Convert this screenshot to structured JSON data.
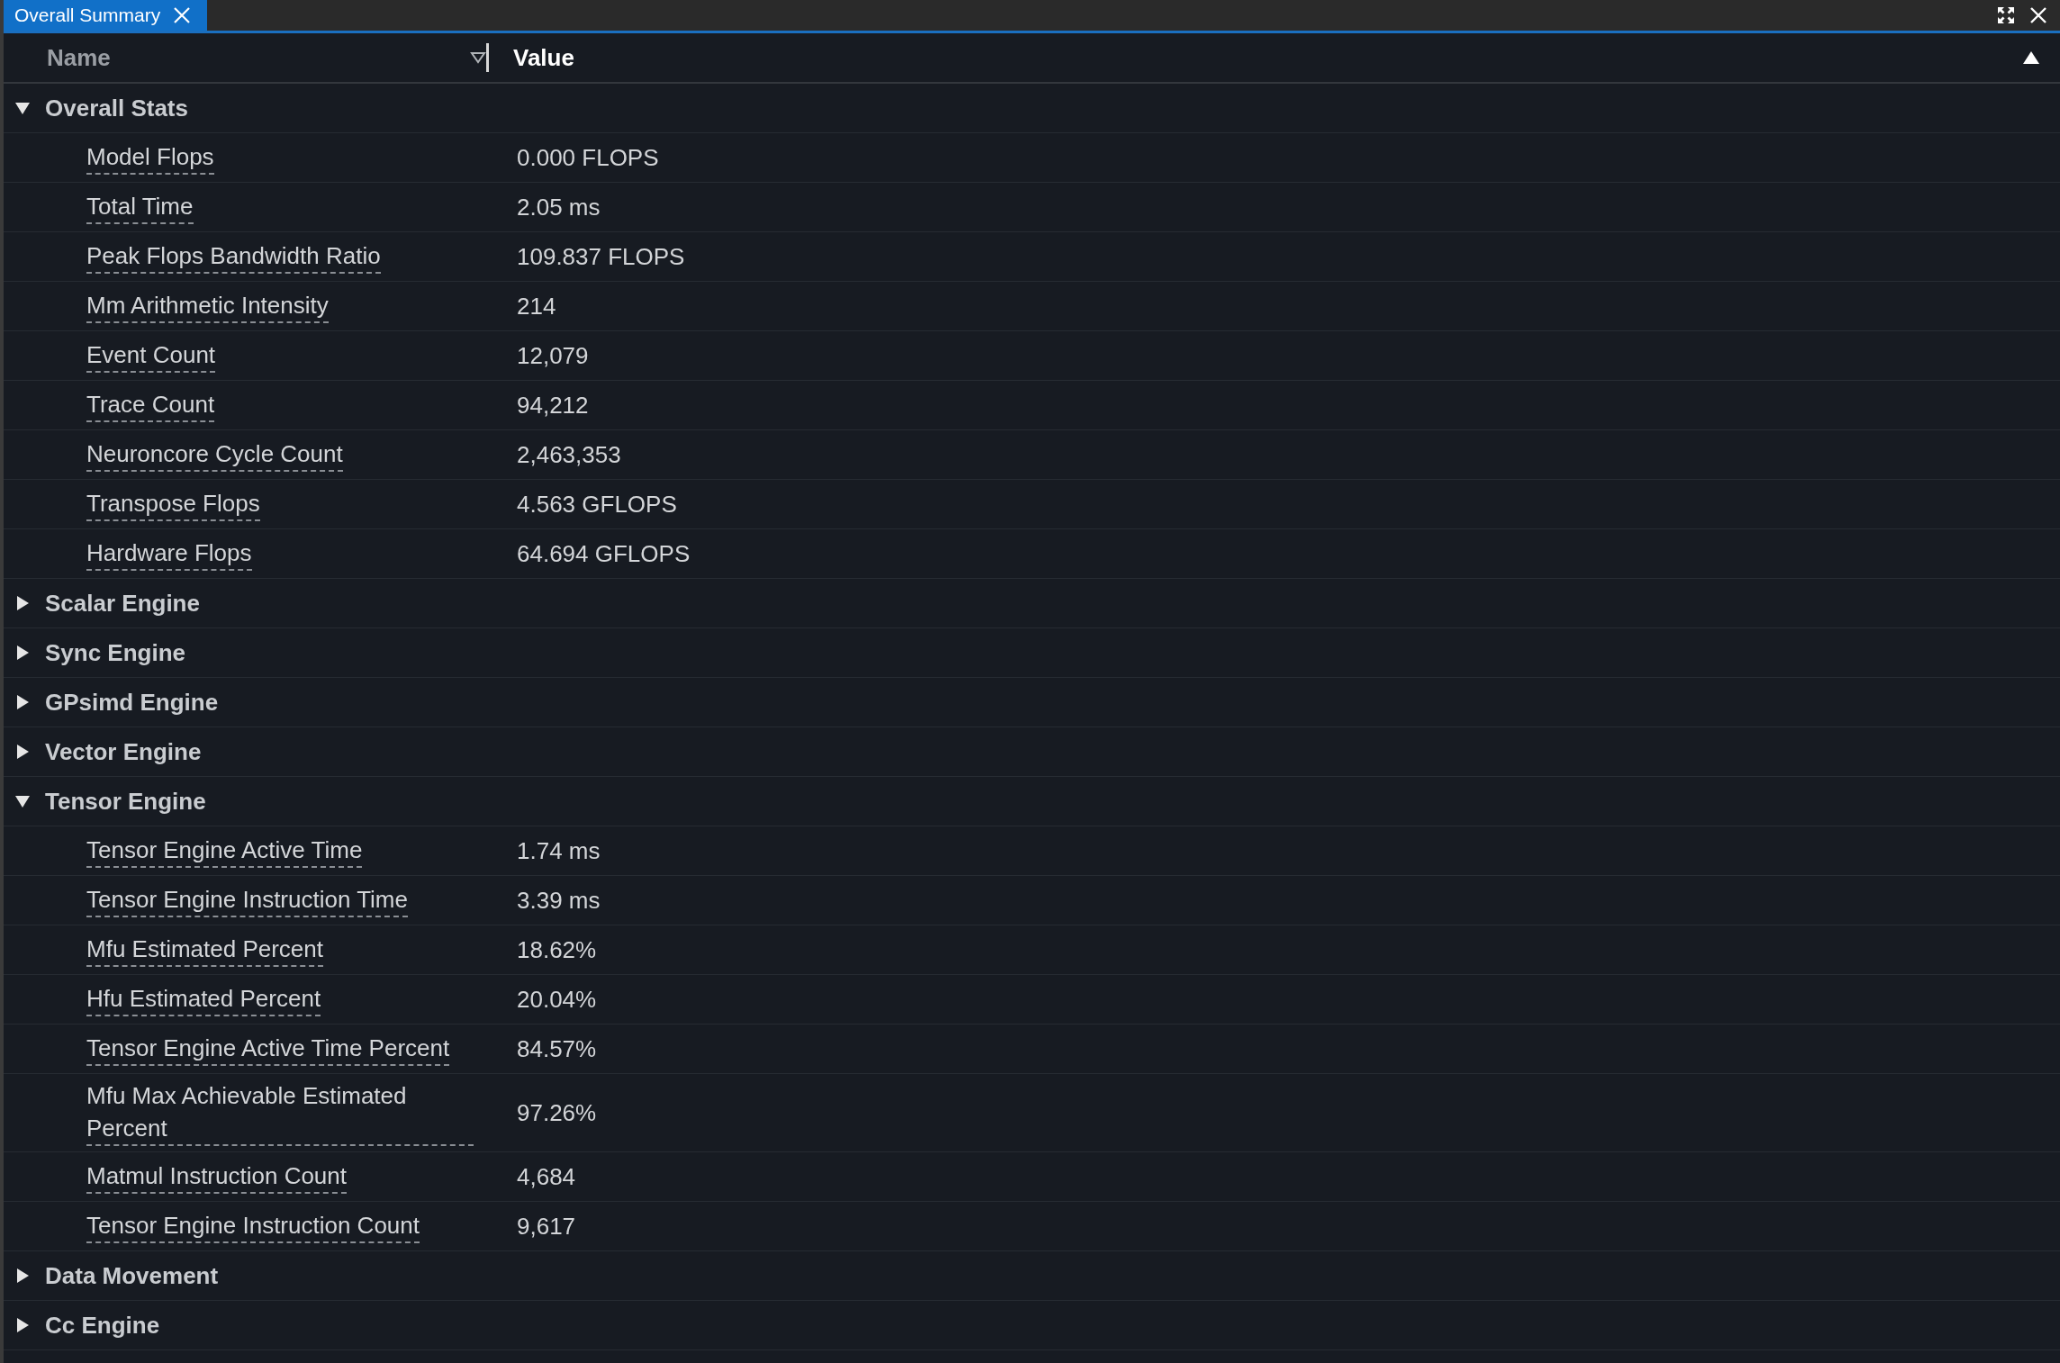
{
  "tab": {
    "label": "Overall Summary",
    "selected": true
  },
  "columns": [
    "Name",
    "Value"
  ],
  "groups": [
    {
      "name": "Overall Stats",
      "expanded": true,
      "children": [
        {
          "name": "Model Flops",
          "value": "0.000 FLOPS"
        },
        {
          "name": "Total Time",
          "value": "2.05 ms"
        },
        {
          "name": "Peak Flops Bandwidth Ratio",
          "value": "109.837 FLOPS"
        },
        {
          "name": "Mm Arithmetic Intensity",
          "value": "214"
        },
        {
          "name": "Event Count",
          "value": "12,079"
        },
        {
          "name": "Trace Count",
          "value": "94,212"
        },
        {
          "name": "Neuroncore Cycle Count",
          "value": "2,463,353"
        },
        {
          "name": "Transpose Flops",
          "value": "4.563 GFLOPS"
        },
        {
          "name": "Hardware Flops",
          "value": "64.694 GFLOPS"
        }
      ]
    },
    {
      "name": "Scalar Engine",
      "expanded": false
    },
    {
      "name": "Sync Engine",
      "expanded": false
    },
    {
      "name": "GPsimd Engine",
      "expanded": false
    },
    {
      "name": "Vector Engine",
      "expanded": false
    },
    {
      "name": "Tensor Engine",
      "expanded": true,
      "children": [
        {
          "name": "Tensor Engine Active Time",
          "value": "1.74 ms"
        },
        {
          "name": "Tensor Engine Instruction Time",
          "value": "3.39 ms"
        },
        {
          "name": "Mfu Estimated Percent",
          "value": "18.62%"
        },
        {
          "name": "Hfu Estimated Percent",
          "value": "20.04%"
        },
        {
          "name": "Tensor Engine Active Time Percent",
          "value": "84.57%"
        },
        {
          "name": "Mfu Max Achievable Estimated Percent",
          "value": "97.26%"
        },
        {
          "name": "Matmul Instruction Count",
          "value": "4,684"
        },
        {
          "name": "Tensor Engine Instruction Count",
          "value": "9,617"
        }
      ]
    },
    {
      "name": "Data Movement",
      "expanded": false
    },
    {
      "name": "Cc Engine",
      "expanded": false
    }
  ]
}
